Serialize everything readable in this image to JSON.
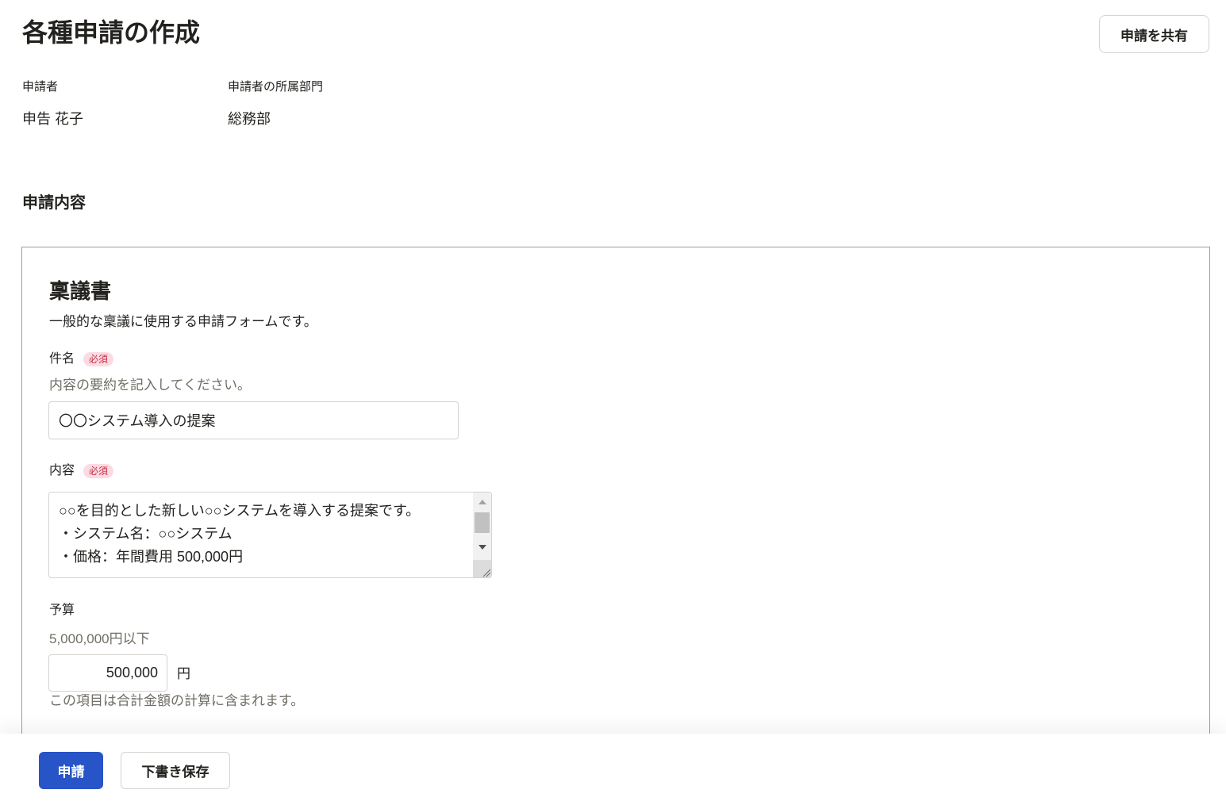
{
  "page": {
    "title": "各種申請の作成",
    "share_button": "申請を共有"
  },
  "applicant": {
    "name_label": "申請者",
    "name_value": "申告 花子",
    "department_label": "申請者の所属部門",
    "department_value": "総務部"
  },
  "section": {
    "title": "申請内容"
  },
  "form": {
    "title": "稟議書",
    "description": "一般的な稟議に使用する申請フォームです。",
    "subject": {
      "label": "件名",
      "required_badge": "必須",
      "hint": "内容の要約を記入してください。",
      "value": "〇〇システム導入の提案"
    },
    "content": {
      "label": "内容",
      "required_badge": "必須",
      "value": "○○を目的とした新しい○○システムを導入する提案です。\n・システム名：○○システム\n・価格：年間費用 500,000円"
    },
    "budget": {
      "label": "予算",
      "hint": "5,000,000円以下",
      "value": "500,000",
      "unit": "円",
      "note": "この項目は合計金額の計算に含まれます。"
    }
  },
  "footer": {
    "submit_button": "申請",
    "draft_button": "下書き保存"
  },
  "icons": {
    "scroll_up": "scroll-up-arrow-icon",
    "scroll_down": "scroll-down-arrow-icon",
    "resize": "resize-grip-icon"
  },
  "colors": {
    "primary": "#2754c6",
    "text": "#23221f",
    "muted": "#706d65",
    "border": "#d6d3d0",
    "panel_border": "#9f9c97",
    "badge_background": "#fbdbe1",
    "badge_text": "#c4314b"
  }
}
